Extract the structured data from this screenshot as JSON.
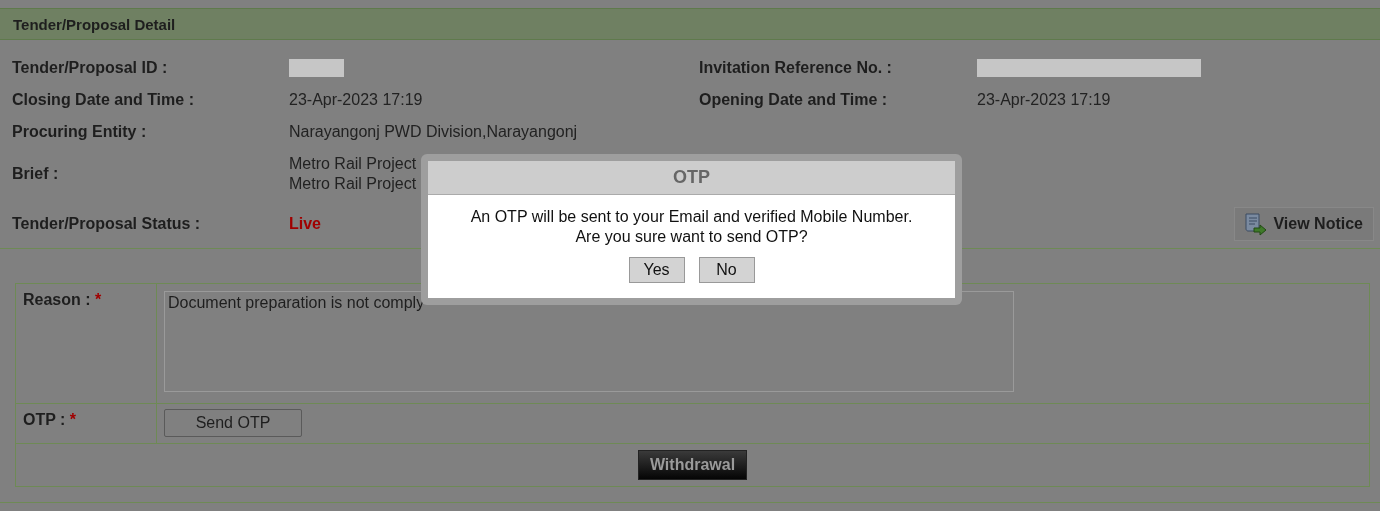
{
  "panel": {
    "title": "Tender/Proposal Detail"
  },
  "details": [
    {
      "label": "Tender/Proposal ID :",
      "kind": "redacted",
      "right": {
        "label": "Invitation Reference No. :",
        "kind": "redacted"
      }
    },
    {
      "label": "Closing Date and Time :",
      "kind": "text",
      "value": "23-Apr-2023 17:19",
      "right": {
        "label": "Opening Date and Time :",
        "kind": "text",
        "value": "23-Apr-2023 17:19"
      }
    },
    {
      "label": "Procuring Entity :",
      "kind": "text",
      "value": "Narayangonj PWD Division,Narayangonj"
    },
    {
      "label": "Brief :",
      "kind": "lines",
      "lines": [
        "Metro Rail Project",
        "Metro Rail Project"
      ]
    },
    {
      "label": "Tender/Proposal Status :",
      "kind": "status",
      "value": "Live"
    }
  ],
  "view_notice": {
    "label": "View Notice"
  },
  "form": {
    "reason_label": "Reason :",
    "reason_required": "*",
    "reason_value": "Document preparation is not comply",
    "otp_label": "OTP :",
    "otp_required": "*",
    "send_otp": "Send OTP",
    "submit": "Withdrawal"
  },
  "dialog": {
    "title": "OTP",
    "message": [
      "An OTP will be sent to your Email and verified Mobile Number.",
      "Are you sure want to send OTP?"
    ],
    "buttons": [
      "Yes",
      "No"
    ]
  }
}
